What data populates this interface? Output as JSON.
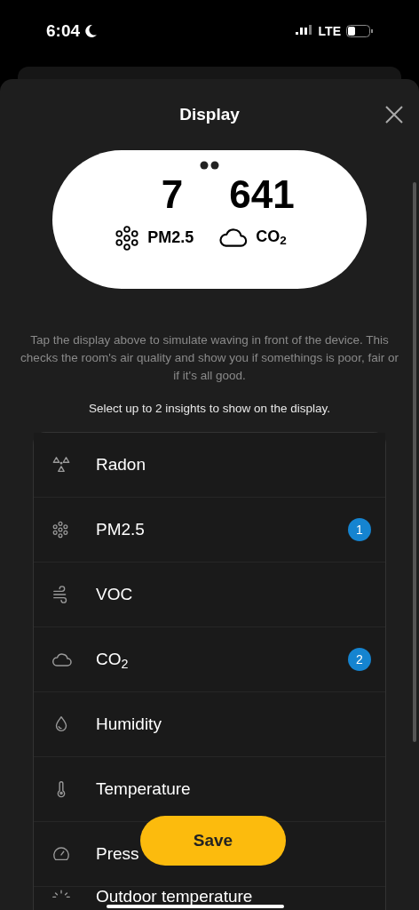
{
  "status_bar": {
    "time": "6:04",
    "network": "LTE"
  },
  "sheet": {
    "title": "Display"
  },
  "display_preview": {
    "readings": [
      {
        "value": "7",
        "label": "PM2.5"
      },
      {
        "value": "641",
        "label": "CO$_{2}$"
      }
    ]
  },
  "description": "Tap the display above to simulate waving in front of the device. This checks the room's air quality and show you if somethings is poor, fair or if it's all good.",
  "instruction": "Select up to 2 insights to show on the display.",
  "insights": [
    {
      "label": "Radon"
    },
    {
      "label": "PM2.5",
      "badge": "1"
    },
    {
      "label": "VOC"
    },
    {
      "label": "CO$_{2}$",
      "badge": "2"
    },
    {
      "label": "Humidity"
    },
    {
      "label": "Temperature"
    },
    {
      "label": "Press"
    },
    {
      "label": "Outdoor temperature"
    }
  ],
  "save_button": "Save"
}
